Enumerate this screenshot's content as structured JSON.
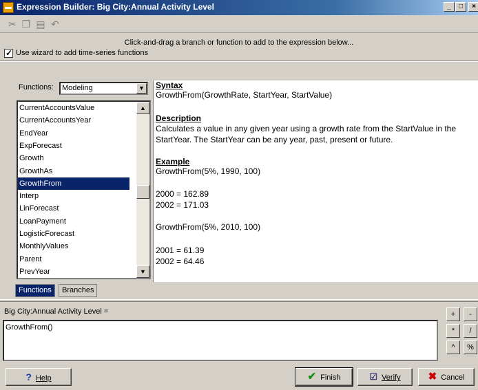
{
  "window": {
    "title": "Expression Builder: Big City:Annual Activity Level"
  },
  "caption_buttons": {
    "minimize": "_",
    "maximize": "□",
    "close": "×"
  },
  "toolbar": {
    "icons": [
      "cut-icon",
      "copy-icon",
      "paste-icon",
      "undo-icon"
    ]
  },
  "instruction": "Click-and-drag a branch or function to add to the expression below...",
  "wizard_checkbox": {
    "label": "Use wizard to add time-series functions",
    "checked": true
  },
  "functions_selector": {
    "label": "Functions:",
    "value": "Modeling"
  },
  "function_list": {
    "items": [
      "CurrentAccountsValue",
      "CurrentAccountsYear",
      "EndYear",
      "ExpForecast",
      "Growth",
      "GrowthAs",
      "GrowthFrom",
      "Interp",
      "LinForecast",
      "LoanPayment",
      "LogisticForecast",
      "MonthlyValues",
      "Parent",
      "PrevYear"
    ],
    "selected": "GrowthFrom"
  },
  "help": {
    "syntax_heading": "Syntax",
    "syntax": "GrowthFrom(GrowthRate, StartYear, StartValue)",
    "description_heading": "Description",
    "description": "Calculates a value in any given year using a growth rate from the StartValue in the StartYear.  The StartYear can be any year, past, present or future.",
    "example_heading": "Example",
    "example1": "GrowthFrom(5%, 1990, 100)",
    "example1_line1": "2000 = 162.89",
    "example1_line2": "2002 = 171.03",
    "example2": "GrowthFrom(5%, 2010, 100)",
    "example2_line1": "2001 = 61.39",
    "example2_line2": "2002 = 64.46"
  },
  "tabs": {
    "functions": "Functions",
    "branches": "Branches"
  },
  "expression": {
    "label": "Big City:Annual Activity Level =",
    "value": "GrowthFrom()"
  },
  "operators": [
    "+",
    "-",
    "*",
    "/",
    "^",
    "%"
  ],
  "buttons": {
    "help": "Help",
    "finish": "Finish",
    "verify": "Verify",
    "cancel": "Cancel"
  },
  "colors": {
    "selection": "#0a246a",
    "title_bar": "#0a246a",
    "finish_check": "#1a8a1a",
    "cancel_x": "#cc0000",
    "help_icon": "#1a3fa8"
  }
}
